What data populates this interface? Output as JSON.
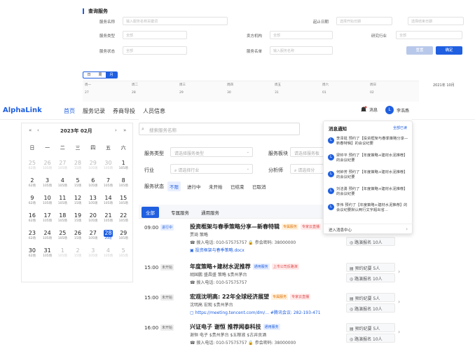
{
  "bg": {
    "query_title": "查询服务",
    "labels": [
      "服务名称",
      "起止日期",
      "服务类型",
      "卖方机构",
      "研究行业",
      "服务状态",
      "服务名单"
    ],
    "ph_name": "输入服务名称关键词",
    "ph_start": "选择开始日期",
    "ph_end": "选择结束日期",
    "ph_all": "全部",
    "ph_list": "输入服务名称",
    "btn_reset": "重置",
    "btn_confirm": "确定",
    "view_tabs": [
      "日",
      "周",
      "月"
    ],
    "week_days": [
      "周一",
      "周二",
      "周三",
      "周四",
      "周五",
      "周六",
      "周日"
    ],
    "week_dates": [
      "27",
      "28",
      "29",
      "30",
      "31",
      "01",
      "02"
    ],
    "mini_title": "2021年 10月"
  },
  "nav": {
    "logo": "AlphaLink",
    "items": [
      "首页",
      "服务记录",
      "券商导投",
      "人员信息"
    ],
    "messages": "消息",
    "user_initial": "L",
    "user_name": "李浩燕"
  },
  "calendar": {
    "title": "2023年 02月",
    "prev_year": "«",
    "prev_month": "‹",
    "next_month": "›",
    "next_year": "»",
    "weekdays": [
      "日",
      "一",
      "二",
      "三",
      "四",
      "五",
      "六"
    ],
    "weeks": [
      [
        [
          "25",
          "62场",
          1
        ],
        [
          "26",
          "105场",
          1
        ],
        [
          "27",
          "105场",
          1
        ],
        [
          "28",
          "15场",
          1
        ],
        [
          "29",
          "105场",
          1
        ],
        [
          "30",
          "105场",
          1
        ],
        [
          "1",
          "105场",
          0
        ]
      ],
      [
        [
          "2",
          "62场",
          0
        ],
        [
          "3",
          "105场",
          0
        ],
        [
          "4",
          "105场",
          0
        ],
        [
          "5",
          "15场",
          0
        ],
        [
          "6",
          "105场",
          0
        ],
        [
          "7",
          "105场",
          0
        ],
        [
          "8",
          "105场",
          0
        ]
      ],
      [
        [
          "9",
          "62场",
          0
        ],
        [
          "10",
          "105场",
          0
        ],
        [
          "11",
          "105场",
          0
        ],
        [
          "12",
          "15场",
          0
        ],
        [
          "13",
          "105场",
          0
        ],
        [
          "14",
          "105场",
          0
        ],
        [
          "15",
          "105场",
          0
        ]
      ],
      [
        [
          "16",
          "62场",
          0
        ],
        [
          "17",
          "105场",
          0
        ],
        [
          "18",
          "105场",
          0
        ],
        [
          "19",
          "15场",
          0
        ],
        [
          "20",
          "105场",
          0
        ],
        [
          "21",
          "105场",
          0
        ],
        [
          "22",
          "105场",
          0
        ]
      ],
      [
        [
          "23",
          "62场",
          0
        ],
        [
          "24",
          "105场",
          0
        ],
        [
          "25",
          "105场",
          0
        ],
        [
          "26",
          "15场",
          0
        ],
        [
          "27",
          "105场",
          0
        ],
        [
          "28",
          "20场",
          2
        ],
        [
          "29",
          "105场",
          0
        ]
      ],
      [
        [
          "30",
          "62场",
          0
        ],
        [
          "31",
          "105场",
          0
        ],
        [
          "1",
          "105场",
          1
        ],
        [
          "2",
          "15场",
          1
        ],
        [
          "3",
          "105场",
          1
        ],
        [
          "4",
          "105场",
          1
        ],
        [
          "5",
          "105场",
          1
        ]
      ]
    ]
  },
  "filters": {
    "search_placeholder": "搜索服务名称",
    "service_type_label": "服务类型",
    "service_type_ph": "请选择服务类型",
    "service_block_label": "服务板块",
    "service_block_ph": "请选择服务板",
    "industry_label": "行业",
    "industry_ph": "请选择行业",
    "analyst_label": "分析师",
    "analyst_ph": "请选择分",
    "status_label": "服务状态",
    "status_chips": [
      "不限",
      "进行中",
      "未开始",
      "已结束",
      "已取消"
    ]
  },
  "tabs": [
    "全部",
    "专属服务",
    "通用服务"
  ],
  "events": [
    {
      "time": "09:00",
      "status": "进行中",
      "title": "投资框架与春季策略分享—新春特辑",
      "tags": [
        "专属服务",
        "专家云直播"
      ],
      "lines": [
        "贾琦  策略",
        "☎ 拨入电话: 010-57575757    🔒 参会密码: 38000000",
        "▣ 投资框架与春季策略.docx"
      ],
      "right": [
        "◎ 路演报名 10人"
      ]
    },
    {
      "time": "15:00",
      "status": "未开始",
      "title": "年度策略+建材水泥推荐",
      "tags": [
        "通用服务",
        "上市公司反路演"
      ],
      "lines": [
        "胡国鹏 盛昌盛  策略  $贵州茅台",
        "☎ 拨入电话: 010-57575757"
      ],
      "right": [
        "▤ 预约纪要 5人",
        "◎ 路演报名 10人"
      ]
    },
    {
      "time": "15:00",
      "status": "未开始",
      "title": "宏观沈明高: 22年全球经济展望",
      "tags": [
        "专属服务",
        "专家云直播"
      ],
      "lines": [
        "沈明高  宏观  $贵州茅台",
        "▢ https://meeting.tencent.com/dm/...  #腾讯会议: 282-193-471"
      ],
      "right": [
        "▤ 预约纪要 5人",
        "◎ 路演报名 10人"
      ]
    },
    {
      "time": "16:00",
      "status": "未开始",
      "title": "兴证电子 谢恒 推荐闻泰科技",
      "tags": [
        "通用服务"
      ],
      "lines": [
        "谢恒  电子  $贵州茅台  $五粮液  $古井贡酒",
        "☎ 拨入电话: 010-57575757    🔒 参会密码: 38000000"
      ],
      "right": [
        "▤ 预约纪要 5人",
        "◎ 路演报名 10人"
      ]
    }
  ],
  "notifications": {
    "title": "消息通知",
    "mark_all": "全部已读",
    "items": [
      "李泽挺 预约了【投资框架与春季策略分享—新春特辑】的会议纪要",
      "梁帅平 预约了【年度策略+建材水泥推荐】的会议纪要",
      "何钟芳 预约了【年度策略+建材水泥推荐】的会议纪要",
      "刘洁勇 预约了【年度策略+建材水泥推荐】的会议纪要",
      "李伟 预约了【年度策略+建材水泥推荐】的会议纪要默认两行文字超出省..."
    ],
    "footer": "进入消息中心"
  },
  "colors": {
    "accent": "#1f5fe0",
    "orange": "#e07000",
    "red": "#e04848"
  }
}
